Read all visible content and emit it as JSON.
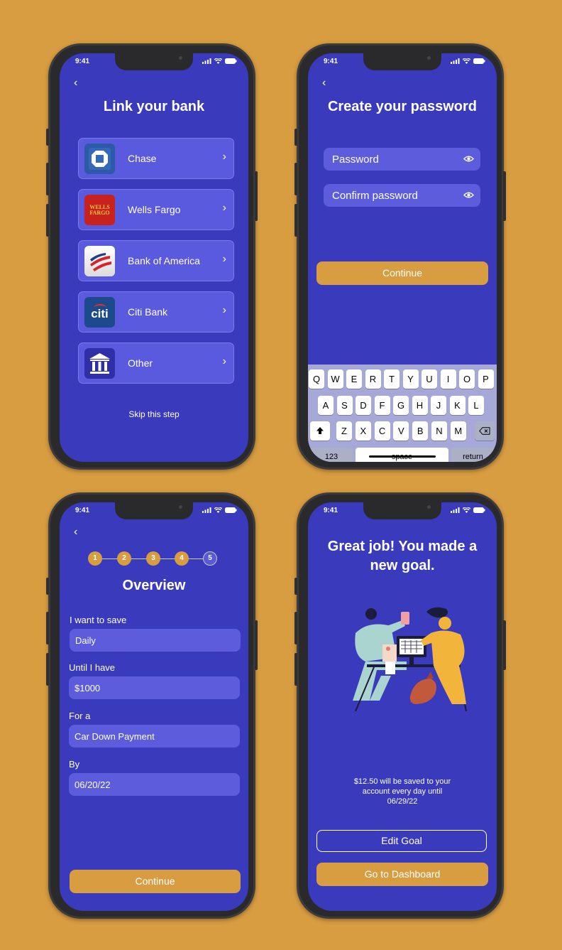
{
  "status": {
    "time": "9:41"
  },
  "screen1": {
    "title": "Link your bank",
    "banks": [
      {
        "label": "Chase",
        "icon": "chase-logo-icon"
      },
      {
        "label": "Wells Fargo",
        "icon": "wells-fargo-logo-icon",
        "logo_text": "WELLS FARGO"
      },
      {
        "label": "Bank of America",
        "icon": "bank-of-america-logo-icon"
      },
      {
        "label": "Citi Bank",
        "icon": "citi-logo-icon",
        "logo_text": "citi"
      },
      {
        "label": "Other",
        "icon": "bank-building-icon"
      }
    ],
    "skip": "Skip this step"
  },
  "screen2": {
    "title": "Create your password",
    "password_placeholder": "Password",
    "confirm_placeholder": "Confirm password",
    "continue": "Continue",
    "keyboard": {
      "row1": [
        "Q",
        "W",
        "E",
        "R",
        "T",
        "Y",
        "U",
        "I",
        "O",
        "P"
      ],
      "row2": [
        "A",
        "S",
        "D",
        "F",
        "G",
        "H",
        "J",
        "K",
        "L"
      ],
      "row3": [
        "Z",
        "X",
        "C",
        "V",
        "B",
        "N",
        "M"
      ],
      "numbers": "123",
      "space": "space",
      "return": "return"
    }
  },
  "screen3": {
    "steps": [
      "1",
      "2",
      "3",
      "4",
      "5"
    ],
    "current_step": 5,
    "title": "Overview",
    "fields": [
      {
        "label": "I want to save",
        "value": "Daily"
      },
      {
        "label": "Until I have",
        "value": "$1000"
      },
      {
        "label": "For a",
        "value": "Car Down Payment"
      },
      {
        "label": "By",
        "value": "06/20/22"
      }
    ],
    "continue": "Continue"
  },
  "screen4": {
    "title_line1": "Great job! You made a",
    "title_line2": "new goal.",
    "message_line1": "$12.50 will be saved to your",
    "message_line2": "account every day until",
    "message_line3": "06/29/22",
    "edit_goal": "Edit Goal",
    "dashboard": "Go to Dashboard"
  },
  "colors": {
    "background": "#D89C41",
    "screen": "#3A3ABD",
    "field": "#5C5CDD",
    "accent": "#D89C41"
  }
}
